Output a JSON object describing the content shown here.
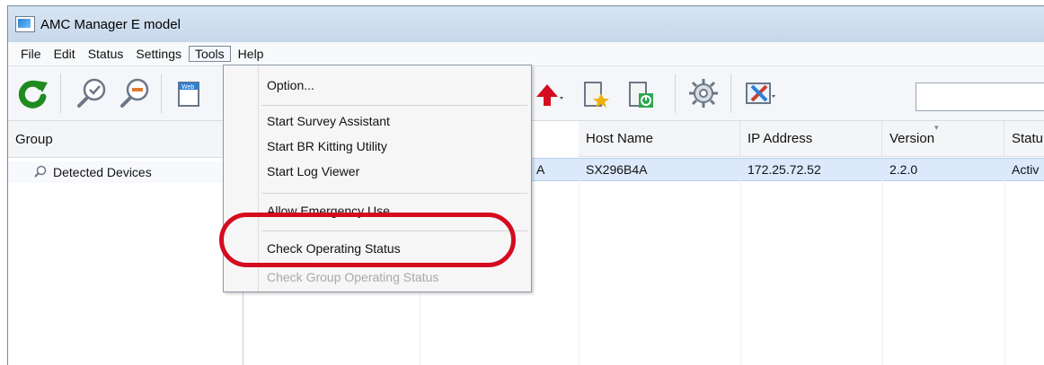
{
  "window": {
    "title": "AMC Manager E model"
  },
  "menubar": [
    "File",
    "Edit",
    "Status",
    "Settings",
    "Tools",
    "Help"
  ],
  "toolbar": {
    "search_placeholder": ""
  },
  "left_pane": {
    "header": "Group",
    "items": [
      "Detected Devices"
    ]
  },
  "table": {
    "columns": [
      "Host Name",
      "IP Address",
      "Version",
      "Statu"
    ],
    "rows": [
      {
        "hidden_prefix": "A",
        "host": "SX296B4A",
        "ip": "172.25.72.52",
        "version": "2.2.0",
        "status": "Activ"
      }
    ]
  },
  "tools_menu": {
    "items": [
      {
        "label": "Option...",
        "enabled": true
      },
      {
        "label": "Start Survey Assistant",
        "enabled": true
      },
      {
        "label": "Start BR Kitting Utility",
        "enabled": true
      },
      {
        "label": "Start Log Viewer",
        "enabled": true
      },
      {
        "label": "Allow Emergency Use",
        "enabled": true
      },
      {
        "label": "Check Operating Status",
        "enabled": true,
        "highlighted": true
      },
      {
        "label": "Check Group Operating Status",
        "enabled": false
      }
    ]
  },
  "colors": {
    "highlight": "#d50b1f",
    "selection": "#dbe9fb"
  }
}
